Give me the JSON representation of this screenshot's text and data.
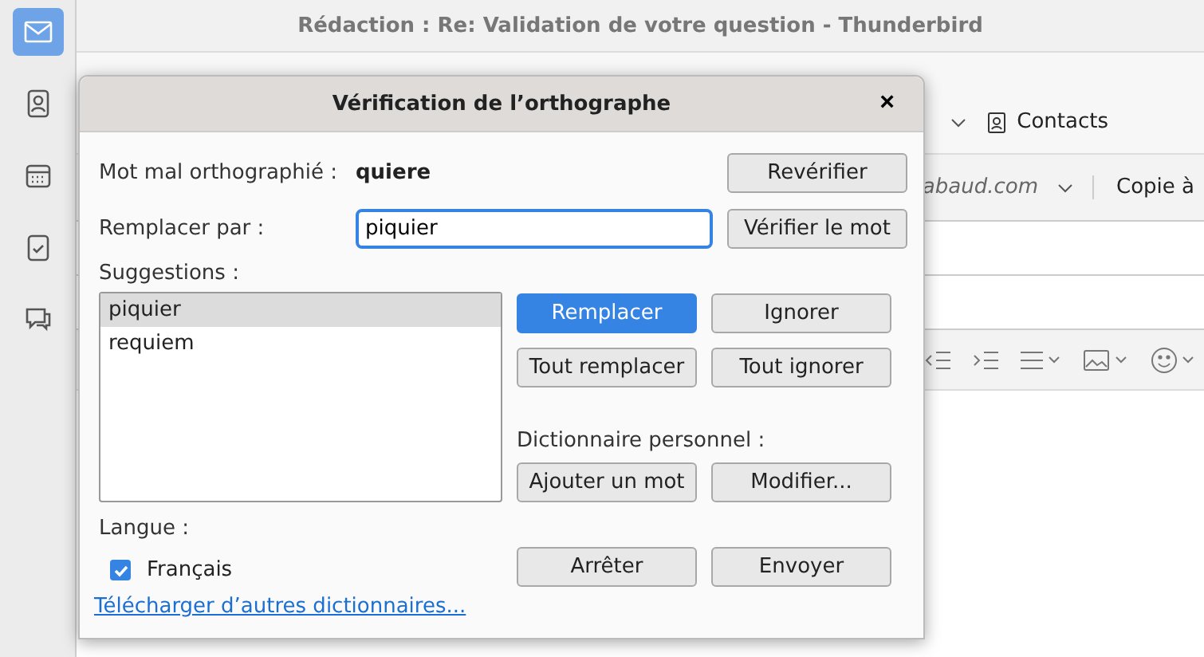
{
  "sidebar": {
    "items": [
      {
        "kind": "mail",
        "selected": true
      },
      {
        "kind": "contacts",
        "selected": false
      },
      {
        "kind": "calendar",
        "selected": false
      },
      {
        "kind": "tasks",
        "selected": false
      },
      {
        "kind": "chat",
        "selected": false
      }
    ]
  },
  "window": {
    "title": "Rédaction : Re: Validation de votre question - Thunderbird"
  },
  "toolbar": {
    "contacts": "Contacts"
  },
  "from_row": {
    "address": "abaud.com",
    "cc": "Copie à"
  },
  "dialog": {
    "title": "Vérification de l’orthographe",
    "close": "×",
    "misspelled_label": "Mot mal orthographié :",
    "misspelled_word": "quiere",
    "replace_label": "Remplacer par :",
    "replace_value": "piquier",
    "suggestions_label": "Suggestions :",
    "suggestions": [
      {
        "text": "piquier",
        "selected": true
      },
      {
        "text": "requiem",
        "selected": false
      }
    ],
    "top_buttons": [
      {
        "label": "Revérifier",
        "default": false
      },
      {
        "label": "Vérifier le mot",
        "default": false
      }
    ],
    "action_buttons": [
      {
        "label": "Remplacer",
        "default": true
      },
      {
        "label": "Ignorer",
        "default": false
      },
      {
        "label": "Tout remplacer",
        "default": false
      },
      {
        "label": "Tout ignorer",
        "default": false
      }
    ],
    "dictionary_label": "Dictionnaire personnel :",
    "dictionary_buttons": [
      {
        "label": "Ajouter un mot",
        "default": false
      },
      {
        "label": "Modifier...",
        "default": false
      }
    ],
    "language_label": "Langue :",
    "languages": [
      {
        "label": "Français",
        "checked": true
      }
    ],
    "bottom_buttons": [
      {
        "label": "Arrêter",
        "default": false
      },
      {
        "label": "Envoyer",
        "default": false
      }
    ],
    "download_link": "Télécharger d’autres dictionnaires..."
  }
}
